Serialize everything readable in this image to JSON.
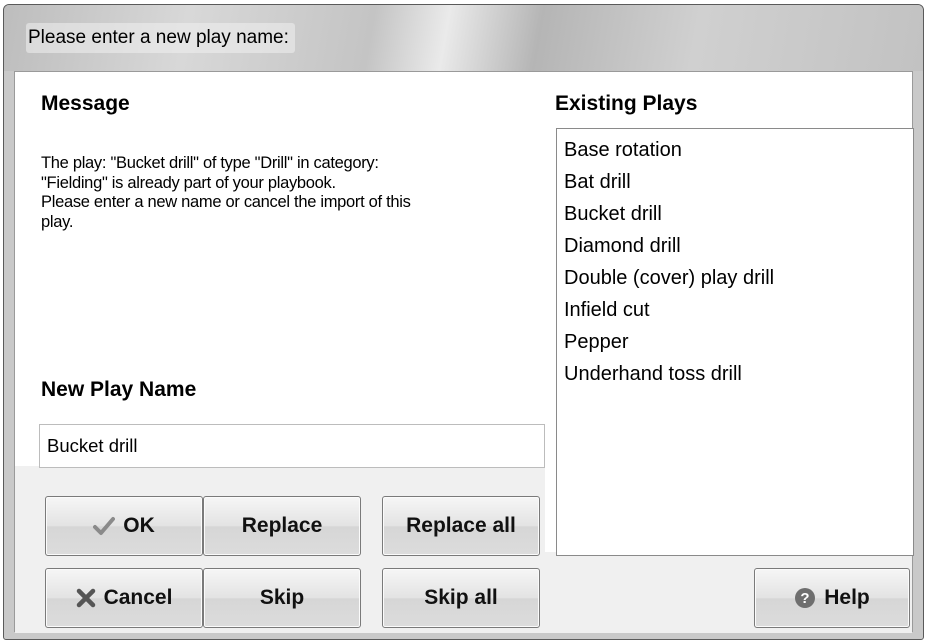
{
  "window": {
    "title": "Please enter a new play name:"
  },
  "message": {
    "heading": "Message",
    "text": "The play: \"Bucket drill\" of type \"Drill\" in category:\n\"Fielding\" is already part of your playbook.\nPlease enter a new name or cancel the import of this\nplay."
  },
  "new_play": {
    "heading": "New Play Name",
    "value": "Bucket drill"
  },
  "existing": {
    "heading": "Existing Plays",
    "items": [
      "Base rotation",
      "Bat drill",
      "Bucket drill",
      "Diamond drill",
      "Double (cover) play drill",
      "Infield cut",
      "Pepper",
      "Underhand toss drill"
    ]
  },
  "buttons": {
    "ok": "OK",
    "replace": "Replace",
    "replace_all": "Replace all",
    "cancel": "Cancel",
    "skip": "Skip",
    "skip_all": "Skip all",
    "help": "Help"
  },
  "icons": {
    "ok": "checkmark-icon",
    "cancel": "cross-icon",
    "help": "help-icon"
  }
}
